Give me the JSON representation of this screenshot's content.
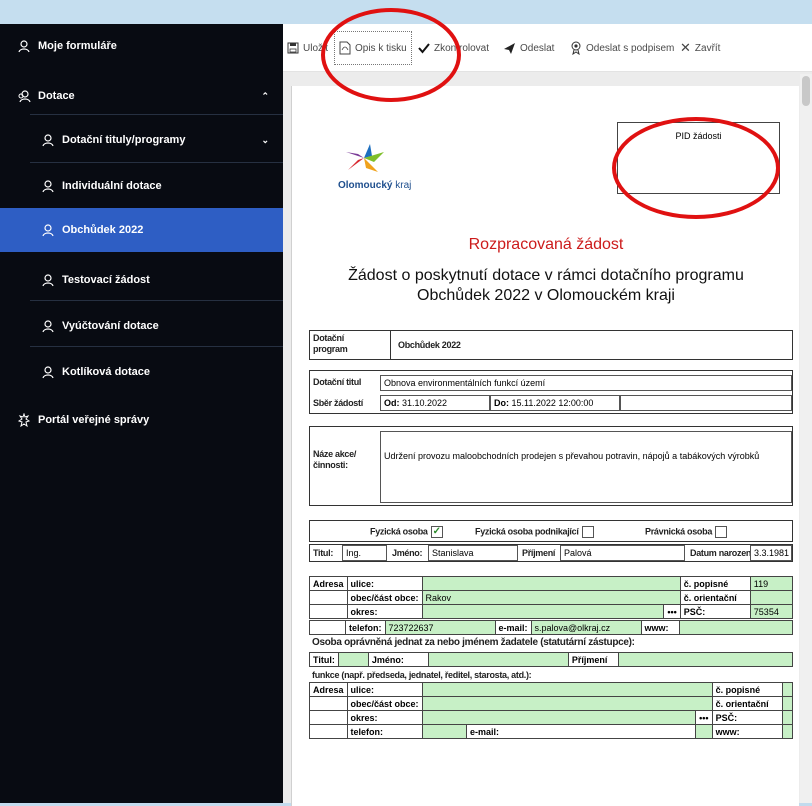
{
  "sidebar": {
    "items": [
      {
        "label": "Moje formuláře",
        "icon": "user-icon"
      },
      {
        "label": "Dotace",
        "icon": "users-icon"
      },
      {
        "label": "Dotační tituly/programy",
        "icon": "user-icon"
      },
      {
        "label": "Individuální dotace",
        "icon": "user-icon"
      },
      {
        "label": "Obchůdek 2022",
        "icon": "user-icon",
        "active": true
      },
      {
        "label": "Testovací žádost",
        "icon": "user-icon"
      },
      {
        "label": "Vyúčtování dotace",
        "icon": "user-icon"
      },
      {
        "label": "Kotlíková dotace",
        "icon": "user-icon"
      },
      {
        "label": "Portál veřejné správy",
        "icon": "emblem-icon"
      }
    ],
    "colors": {
      "background": "#080b12",
      "active": "#2e5ec4"
    }
  },
  "toolbar": {
    "save": "Uložit",
    "print": "Opis k tisku",
    "check": "Zkontrolovat",
    "send": "Odeslat",
    "send_signed": "Odeslat s podpisem",
    "close": "Zavřít"
  },
  "doc": {
    "pid_label": "PID žádosti",
    "logo_brand": "Olomoucký",
    "logo_region": "kraj",
    "status": "Rozpracovaná žádost",
    "title_line1": "Žádost o poskytnutí dotace v rámci dotačního programu",
    "title_line2": "Obchůdek 2022 v Olomouckém kraji",
    "program_label": "Dotační program",
    "program_value": "Obchůdek 2022",
    "titul_label": "Dotační titul",
    "titul_value": "Obnova environmentálních funkcí území",
    "sber_label": "Sběr žádostí",
    "od_label": "Od:",
    "od_value": "31.10.2022",
    "do_label": "Do:",
    "do_value": "15.11.2022 12:00:00",
    "akce_label": "Náze akce/ činnosti:",
    "akce_value": "Udržení provozu maloobchodních prodejen s převahou potravin, nápojů a tabákových výrobků",
    "fo_label": "Fyzická osoba",
    "fop_label": "Fyzická osoba podnikající",
    "po_label": "Právnická osoba",
    "titul_os_label": "Titul:",
    "titul_os_value": "Ing.",
    "jmeno_label": "Jméno:",
    "jmeno_value": "Stanislava",
    "prijmeni_label": "Příjmení",
    "prijmeni_value": "Palová",
    "datum_label": "Datum narození:",
    "datum_value": "3.3.1981",
    "adresa_label": "Adresa",
    "ulice_label": "ulice:",
    "popisne_label": "č. popisné",
    "popisne_value": "119",
    "obec_label": "obec/část obce:",
    "obec_value": "Rakov",
    "orientacni_label": "č. orientační",
    "okres_label": "okres:",
    "dots": "•••",
    "psc_label": "PSČ:",
    "psc_value": "75354",
    "telefon_label": "telefon:",
    "telefon_value": "723722637",
    "email_label": "e-mail:",
    "email_value": "s.palova@olkraj.cz",
    "www_label": "www:",
    "osoba_header": "Osoba oprávněná jednat za nebo jménem žadatele (statutární zástupce):",
    "funkce_label": "funkce (např. předseda, jednatel, ředitel, starosta, atd.):"
  }
}
